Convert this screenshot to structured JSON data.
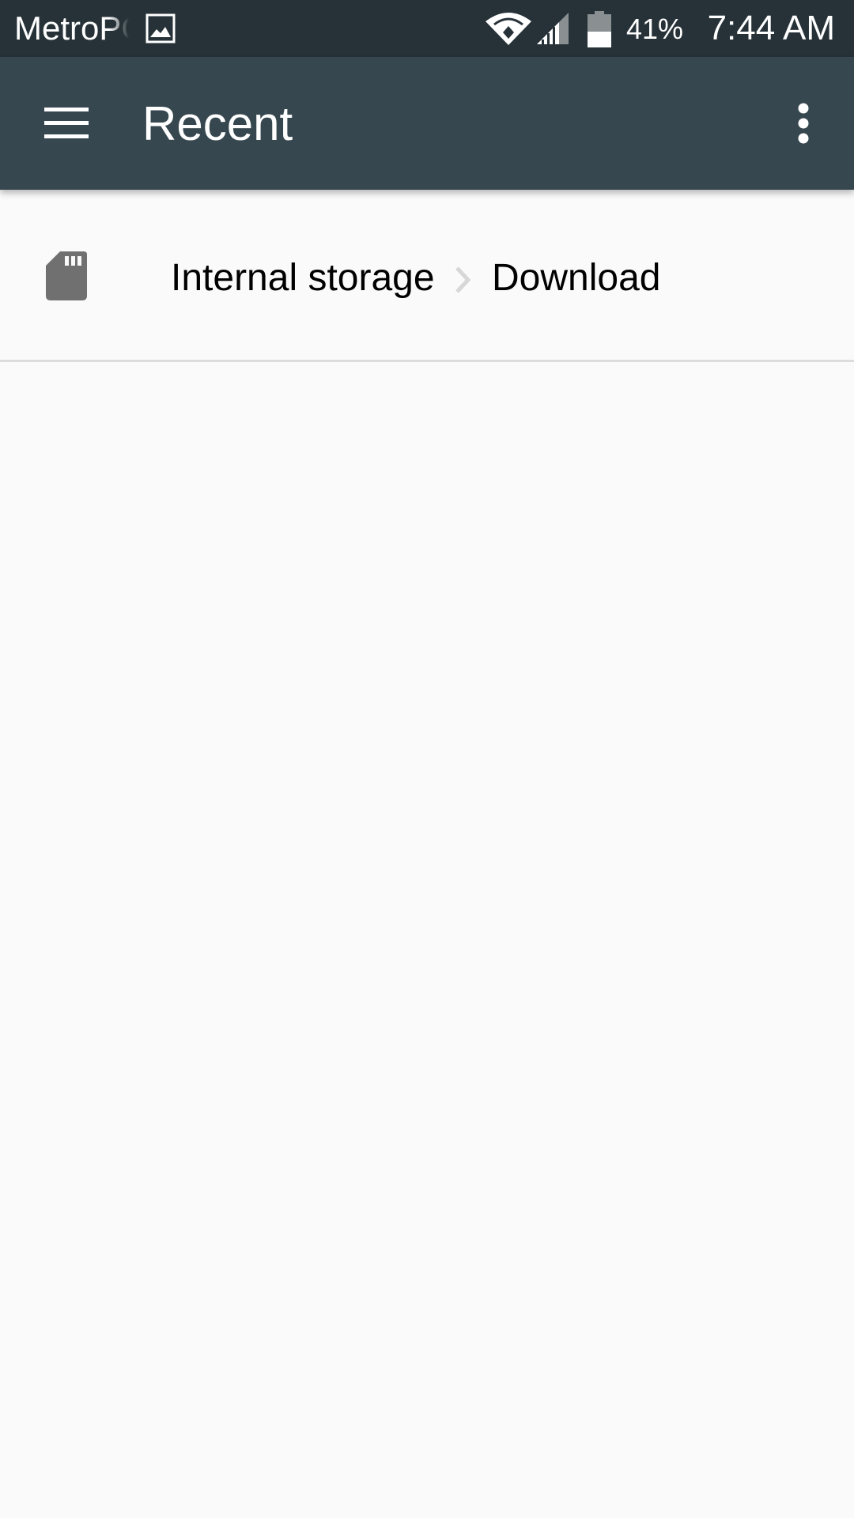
{
  "status_bar": {
    "carrier": "MetroPCS",
    "battery_percent": "41%",
    "time": "7:44 AM",
    "icons": [
      "picture-icon",
      "wifi-icon",
      "signal-icon",
      "battery-icon"
    ]
  },
  "app_bar": {
    "title": "Recent",
    "menu_icon": "hamburger-menu-icon",
    "overflow_icon": "more-vert-icon",
    "background": "#37474f"
  },
  "breadcrumb": {
    "root_icon": "sd-card-icon",
    "items": [
      "Internal storage",
      "Download"
    ],
    "separator_icon": "chevron-right-icon"
  },
  "colors": {
    "status_bar": "#263238",
    "app_bar": "#37474f",
    "background": "#fafafa",
    "icon_gray": "#707070"
  }
}
